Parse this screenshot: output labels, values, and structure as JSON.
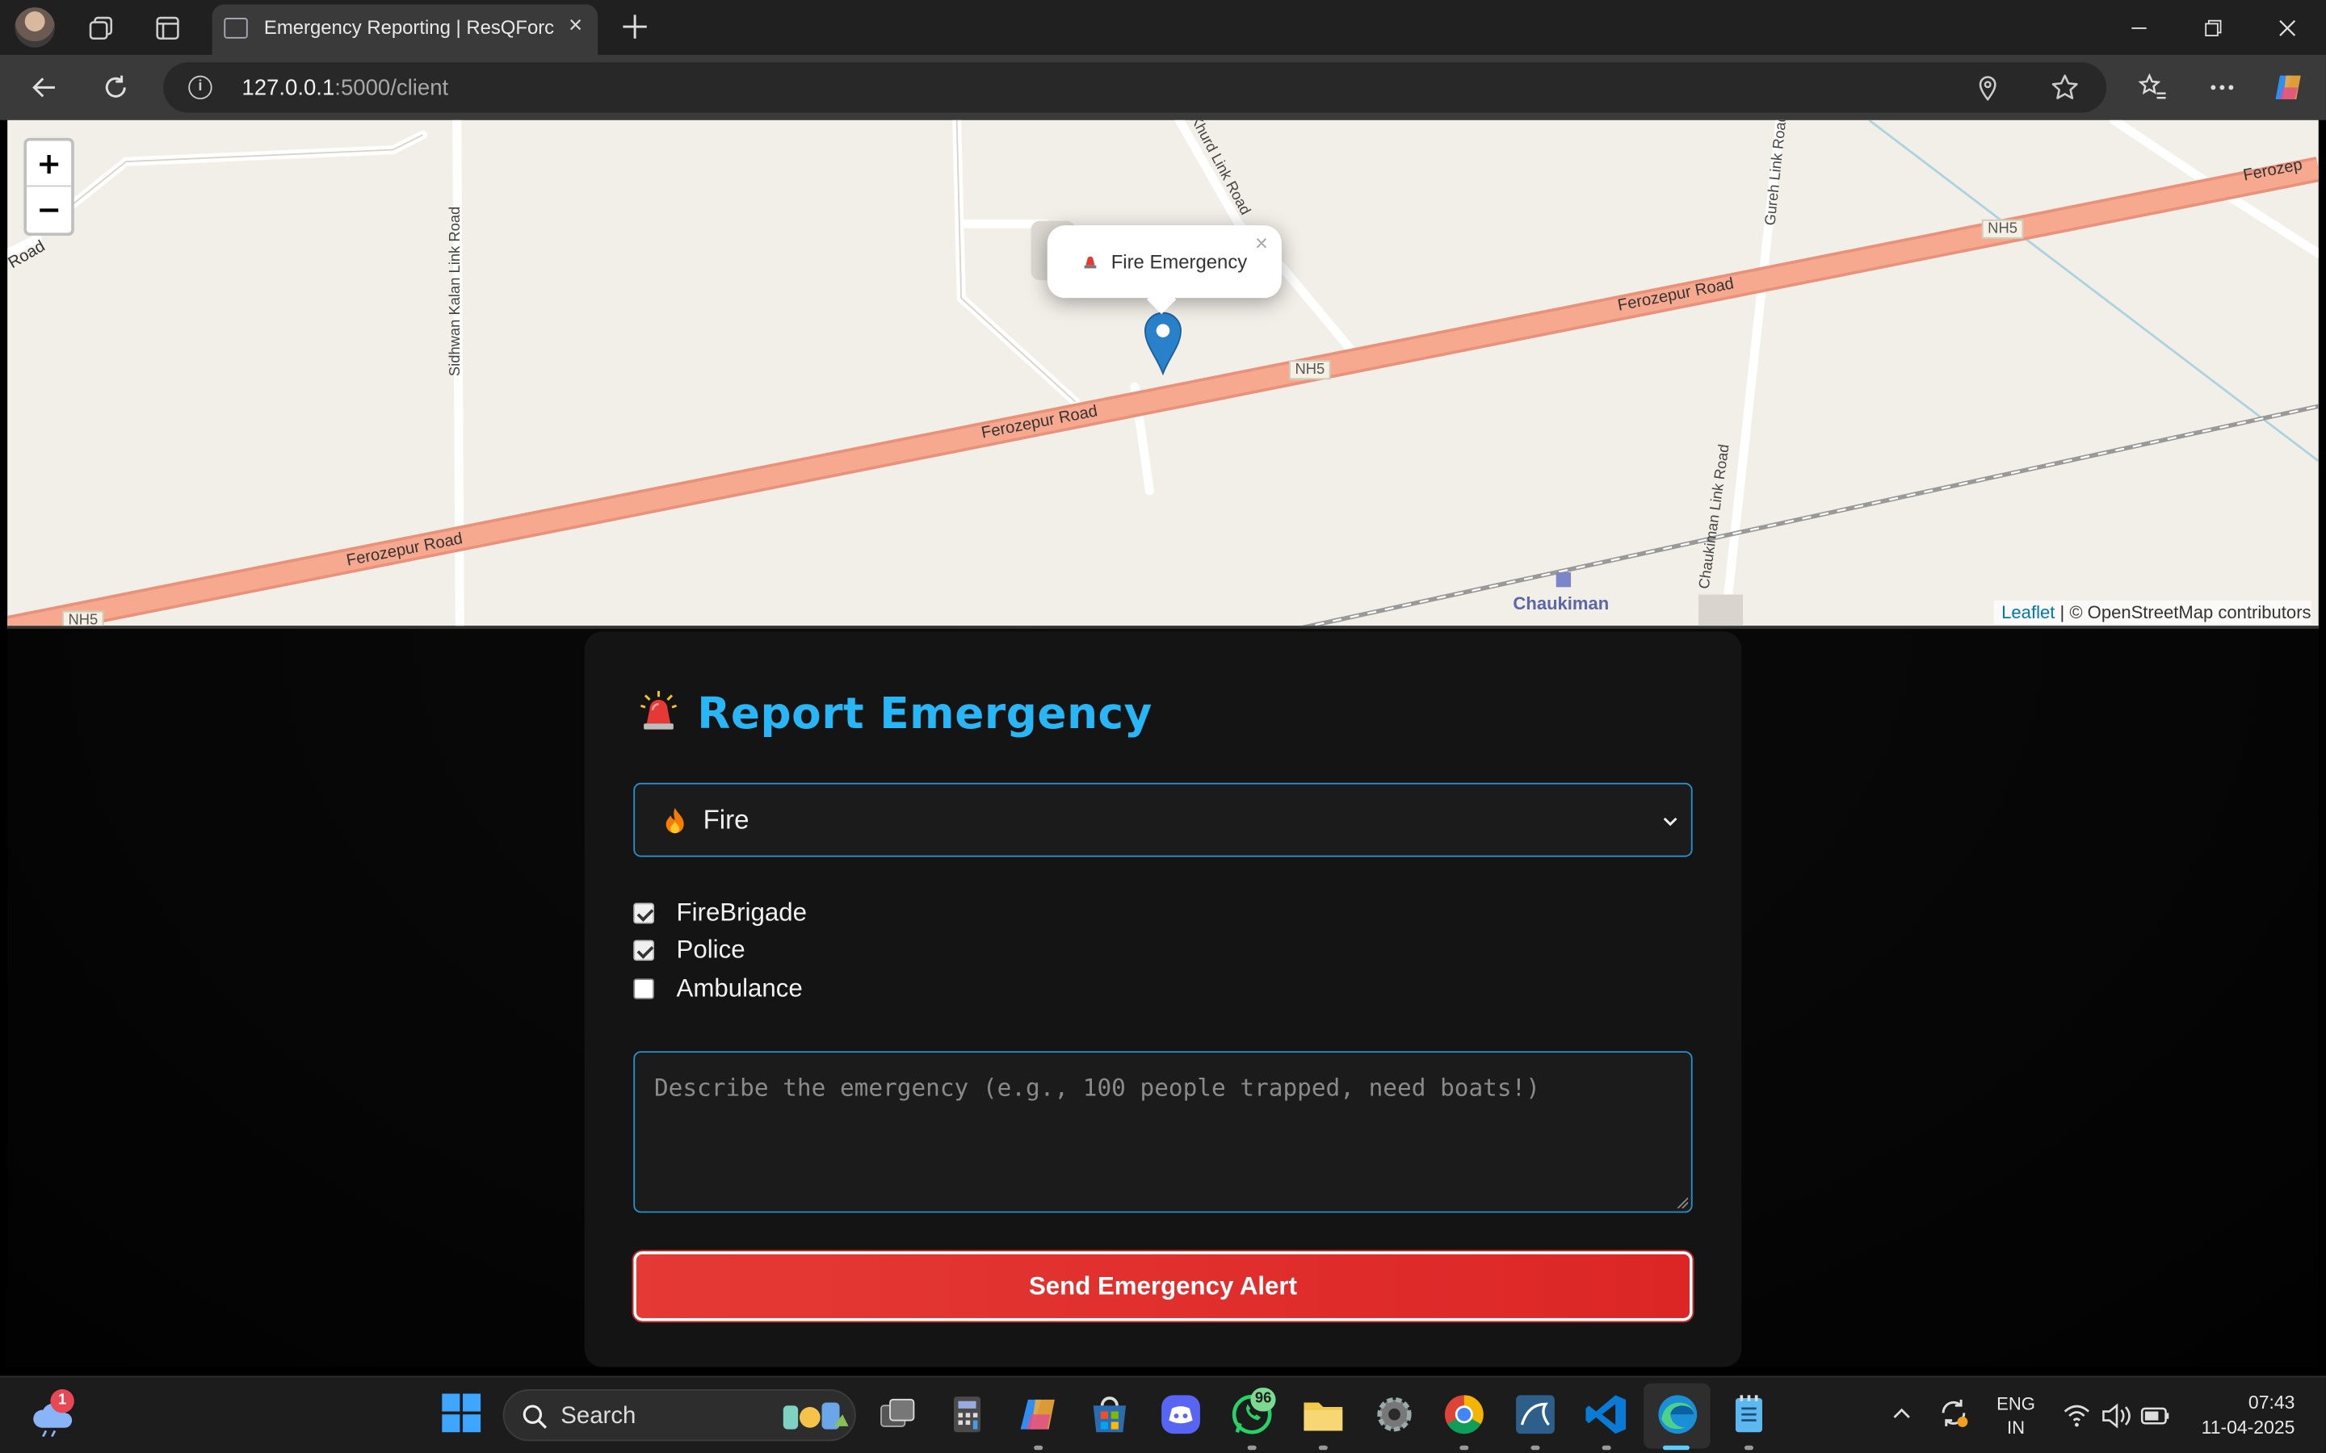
{
  "browser": {
    "tab_title": "Emergency Reporting | ResQForce",
    "tab_close": "×",
    "url_host": "127.0.0.1",
    "url_rest": ":5000/client"
  },
  "map": {
    "zoom_in": "+",
    "zoom_out": "−",
    "popup_text": "Fire Emergency",
    "popup_close": "×",
    "attribution_link": "Leaflet",
    "attribution_rest": " | © OpenStreetMap contributors",
    "labels": {
      "ferozepur_road_1": "Ferozepur Road",
      "ferozepur_road_2": "Ferozepur Road",
      "ferozepur_road_3": "Ferozepur Road",
      "ferozepur_road_4": "Ferozepur Road",
      "ferozepur_road_left": "Road",
      "nh5_1": "NH5",
      "nh5_2": "NH5",
      "nh5_3": "NH5",
      "sidhwan": "Sidhwan Kalan Link Road",
      "khurd": "Khurd Link Road",
      "gureh": "Gureh Link Road",
      "chaukiman_road": "Chaukiman Link Road",
      "chaukiman": "Chaukiman",
      "ferozep_right": "Ferozep"
    }
  },
  "form": {
    "title": "Report Emergency",
    "type_selected": "Fire",
    "services": [
      {
        "label": "FireBrigade",
        "checked": true
      },
      {
        "label": "Police",
        "checked": true
      },
      {
        "label": "Ambulance",
        "checked": false
      }
    ],
    "description_placeholder": "Describe the emergency (e.g., 100 people trapped, need boats!)",
    "description_value": "",
    "submit_label": "Send Emergency Alert",
    "accent_color": "#29b6f6",
    "danger_color": "#dc2626"
  },
  "taskbar": {
    "search_label": "Search",
    "weather_badge": "1",
    "whatsapp_badge": "96",
    "lang_line1": "ENG",
    "lang_line2": "IN",
    "time": "07:43",
    "date": "11-04-2025"
  }
}
